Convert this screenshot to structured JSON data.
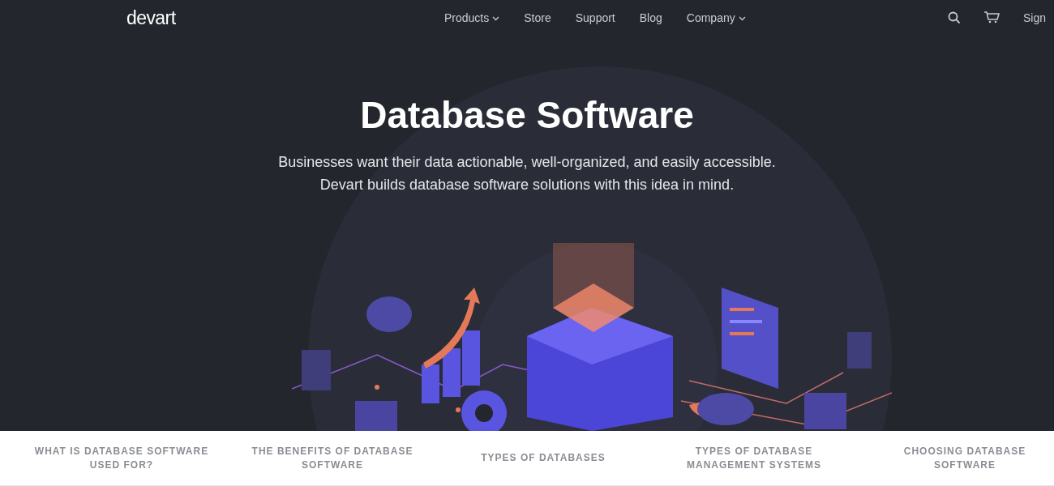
{
  "header": {
    "logo": "devart",
    "nav": [
      {
        "label": "Products",
        "has_dropdown": true
      },
      {
        "label": "Store",
        "has_dropdown": false
      },
      {
        "label": "Support",
        "has_dropdown": false
      },
      {
        "label": "Blog",
        "has_dropdown": false
      },
      {
        "label": "Company",
        "has_dropdown": true
      }
    ],
    "sign_in": "Sign"
  },
  "hero": {
    "title": "Database Software",
    "lines": [
      "Businesses want their data actionable, well-organized, and easily accessible.",
      "Devart builds database software solutions with this idea in mind."
    ]
  },
  "section_nav": [
    {
      "lines": [
        "WHAT IS DATABASE SOFTWARE",
        "USED FOR?"
      ]
    },
    {
      "lines": [
        "THE BENEFITS OF DATABASE",
        "SOFTWARE"
      ]
    },
    {
      "lines": [
        "TYPES OF DATABASES"
      ]
    },
    {
      "lines": [
        "TYPES OF DATABASE",
        "MANAGEMENT SYSTEMS"
      ]
    },
    {
      "lines": [
        "CHOOSING DATABASE",
        "SOFTWARE"
      ]
    }
  ]
}
